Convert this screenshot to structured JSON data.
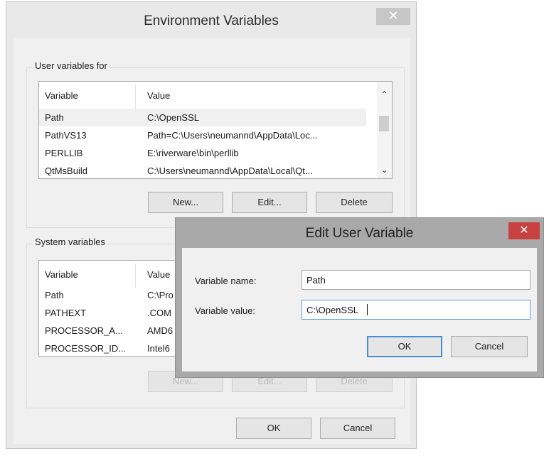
{
  "env_window": {
    "title": "Environment Variables",
    "close_glyph": "✕",
    "user_group": {
      "legend": "User variables for",
      "columns": [
        "Variable",
        "Value"
      ],
      "rows": [
        {
          "variable": "Path",
          "value": "C:\\OpenSSL"
        },
        {
          "variable": "PathVS13",
          "value": "Path=C:\\Users\\neumannd\\AppData\\Loc..."
        },
        {
          "variable": "PERLLIB",
          "value": "E:\\riverware\\bin\\perllib"
        },
        {
          "variable": "QtMsBuild",
          "value": "C:\\Users\\neumannd\\AppData\\Local\\Qt..."
        }
      ],
      "scroll_up_glyph": "⌃",
      "scroll_down_glyph": "⌄",
      "buttons": {
        "new": "New...",
        "edit": "Edit...",
        "delete": "Delete"
      }
    },
    "system_group": {
      "legend": "System variables",
      "columns": [
        "Variable",
        "Value"
      ],
      "rows": [
        {
          "variable": "Path",
          "value": "C:\\Pro"
        },
        {
          "variable": "PATHEXT",
          "value": ".COM"
        },
        {
          "variable": "PROCESSOR_A...",
          "value": "AMD6"
        },
        {
          "variable": "PROCESSOR_ID...",
          "value": "Intel6"
        }
      ],
      "buttons": {
        "new": "New...",
        "edit": "Edit...",
        "delete": "Delete"
      }
    },
    "ok_label": "OK",
    "cancel_label": "Cancel"
  },
  "edit_dialog": {
    "title": "Edit User Variable",
    "close_glyph": "✕",
    "name_label": "Variable name:",
    "name_value": "Path",
    "value_label": "Variable value:",
    "value_value": "C:\\OpenSSL",
    "ok_label": "OK",
    "cancel_label": "Cancel"
  },
  "colors": {
    "close_active": "#c94040",
    "focus_border": "#5f9cd6",
    "default_button_border": "#4a8ed0"
  }
}
